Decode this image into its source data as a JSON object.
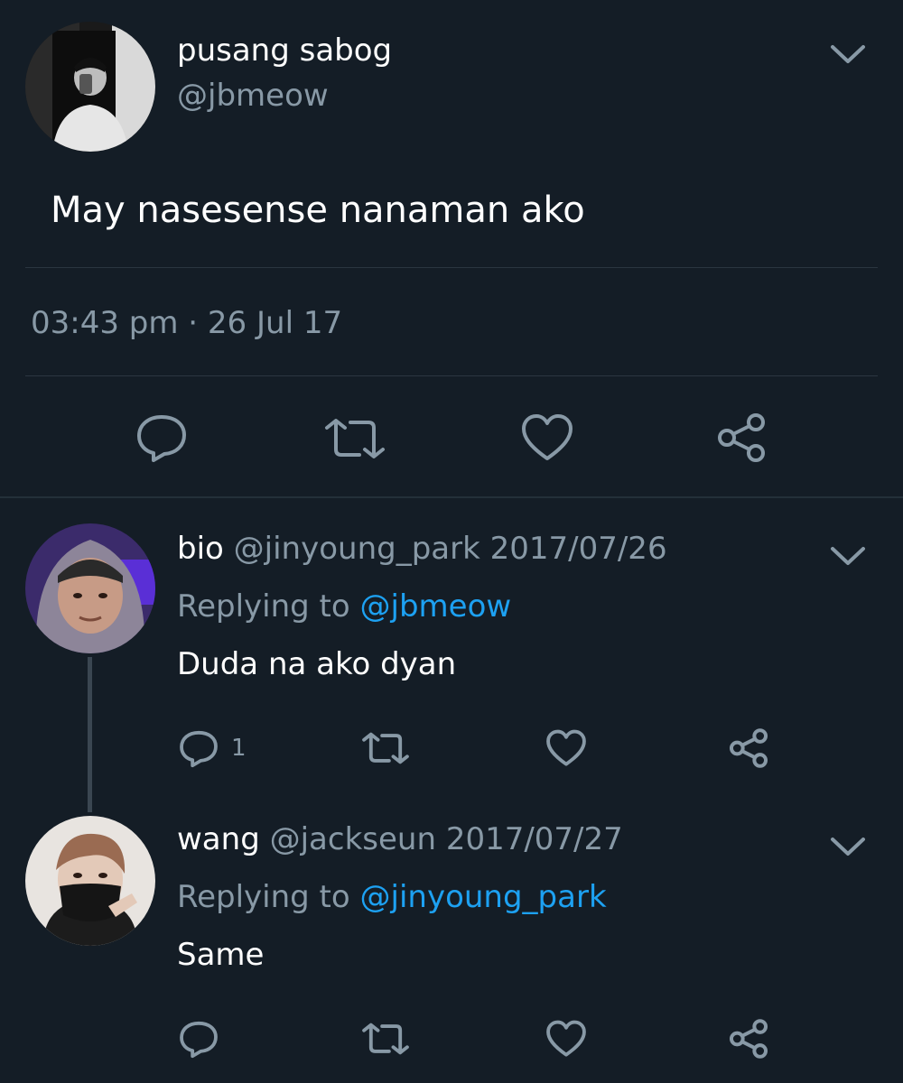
{
  "main_tweet": {
    "display_name": "pusang sabog",
    "handle": "@jbmeow",
    "text": "May nasesense nanaman ako",
    "timestamp": "03:43 pm · 26 Jul 17",
    "actions": [
      "reply-icon",
      "retweet-icon",
      "like-icon",
      "share-icon"
    ]
  },
  "replies": [
    {
      "display_name": "bio",
      "handle": "@jinyoung_park",
      "date": "2017/07/26",
      "replying_prefix": "Replying to",
      "replying_handle": "@jbmeow",
      "text": "Duda na ako dyan",
      "reply_count": "1"
    },
    {
      "display_name": "wang",
      "handle": "@jackseun",
      "date": "2017/07/27",
      "replying_prefix": "Replying to",
      "replying_handle": "@jinyoung_park",
      "text": "Same",
      "reply_count": ""
    }
  ],
  "colors": {
    "background": "#141d26",
    "muted": "#8899a6",
    "link": "#1da1f2",
    "divider": "#2b3640"
  }
}
